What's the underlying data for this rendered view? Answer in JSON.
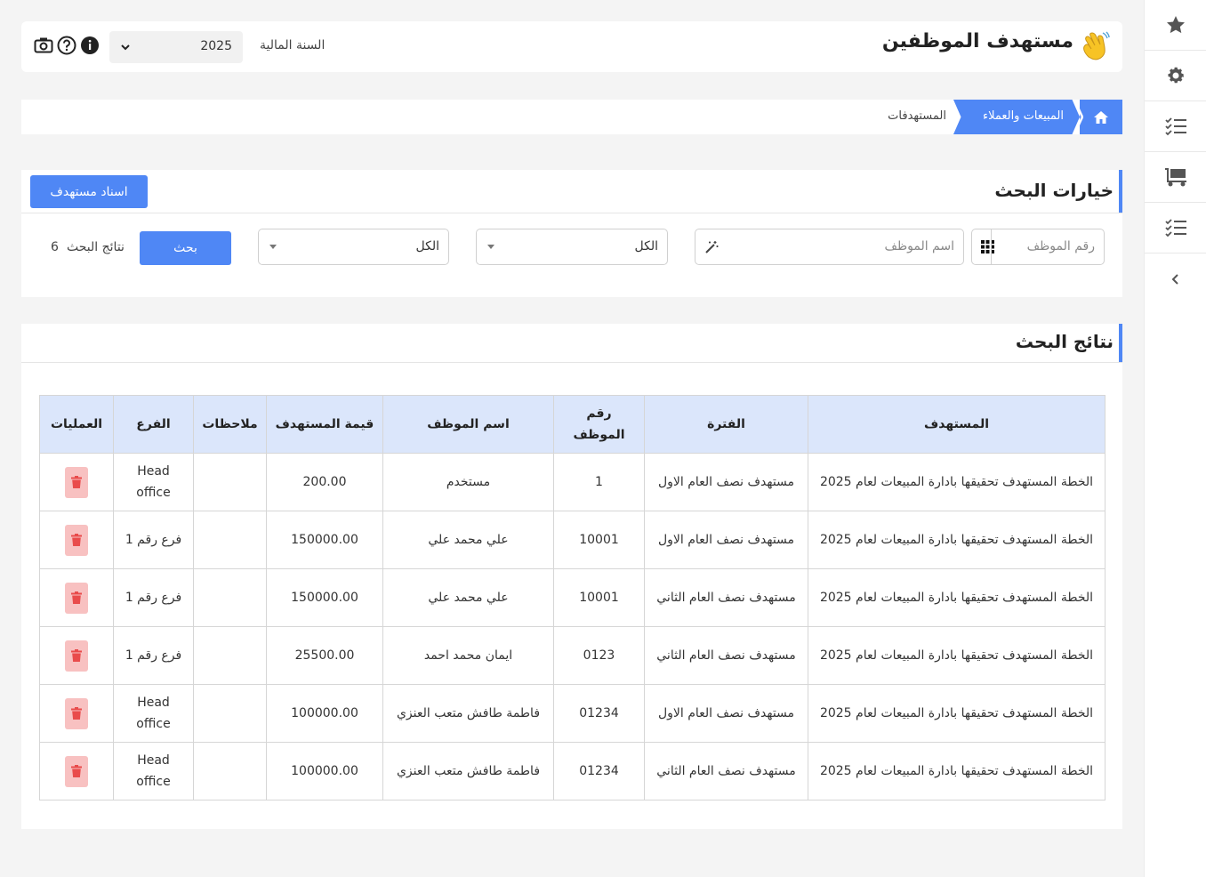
{
  "header": {
    "title": "مستهدف الموظفين",
    "fiscal_year_label": "السنة المالية",
    "fiscal_year_value": "2025"
  },
  "breadcrumb": {
    "items": [
      "المبيعات والعملاء",
      "المستهدفات"
    ]
  },
  "search": {
    "title": "خيارات البحث",
    "assign_button": "اسناد مستهدف",
    "employee_number_placeholder": "رقم الموظف",
    "employee_name_placeholder": "اسم الموظف",
    "filter1_value": "الكل",
    "filter2_value": "الكل",
    "search_button": "بحث",
    "results_label": "نتائج البحث",
    "results_count": "6"
  },
  "results": {
    "title": "نتائج البحث",
    "columns": [
      "المستهدف",
      "الفترة",
      "رقم الموظف",
      "اسم الموظف",
      "قيمة المستهدف",
      "ملاحظات",
      "الفرع",
      "العمليات"
    ],
    "rows": [
      {
        "target": "الخطة المستهدف تحقيقها بادارة المبيعات لعام 2025",
        "period": "مستهدف نصف العام الاول",
        "emp_no": "1",
        "emp_name": "مستخدم",
        "value": "200.00",
        "notes": "",
        "branch": "Head office"
      },
      {
        "target": "الخطة المستهدف تحقيقها بادارة المبيعات لعام 2025",
        "period": "مستهدف نصف العام الاول",
        "emp_no": "10001",
        "emp_name": "علي محمد علي",
        "value": "150000.00",
        "notes": "",
        "branch": "فرع رقم 1"
      },
      {
        "target": "الخطة المستهدف تحقيقها بادارة المبيعات لعام 2025",
        "period": "مستهدف نصف العام الثاني",
        "emp_no": "10001",
        "emp_name": "علي محمد علي",
        "value": "150000.00",
        "notes": "",
        "branch": "فرع رقم 1"
      },
      {
        "target": "الخطة المستهدف تحقيقها بادارة المبيعات لعام 2025",
        "period": "مستهدف نصف العام الثاني",
        "emp_no": "0123",
        "emp_name": "ايمان محمد احمد",
        "value": "25500.00",
        "notes": "",
        "branch": "فرع رقم 1"
      },
      {
        "target": "الخطة المستهدف تحقيقها بادارة المبيعات لعام 2025",
        "period": "مستهدف نصف العام الاول",
        "emp_no": "01234",
        "emp_name": "فاطمة طافش متعب العنزي",
        "value": "100000.00",
        "notes": "",
        "branch": "Head office"
      },
      {
        "target": "الخطة المستهدف تحقيقها بادارة المبيعات لعام 2025",
        "period": "مستهدف نصف العام الثاني",
        "emp_no": "01234",
        "emp_name": "فاطمة طافش متعب العنزي",
        "value": "100000.00",
        "notes": "",
        "branch": "Head office"
      }
    ]
  },
  "icons": {
    "sidebar": [
      "star-icon",
      "gear-icon",
      "checklist-icon",
      "truck-icon",
      "checklist-icon",
      "chevron-left-icon"
    ],
    "topbar": [
      "camera-icon",
      "help-icon",
      "info-icon"
    ]
  },
  "colors": {
    "accent": "#4f87f5",
    "table_header": "#dbe6fb",
    "delete": "#e94b4b",
    "delete_bg": "#f8c1c1"
  }
}
